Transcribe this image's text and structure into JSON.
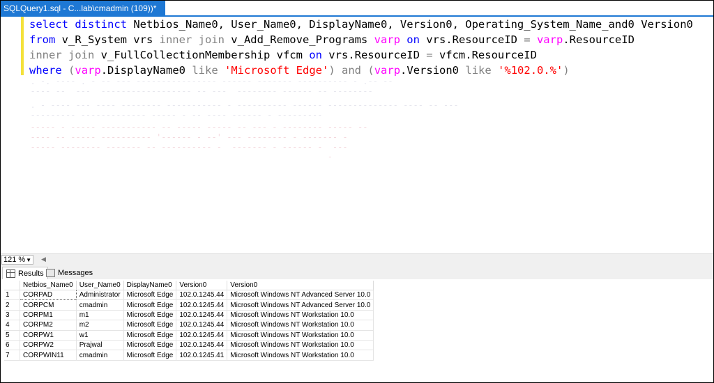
{
  "tab": {
    "title": "SQLQuery1.sql - C...lab\\cmadmin (109))*",
    "pin": "⊕",
    "close": "✕"
  },
  "editor": {
    "zoom": "121 %",
    "lines": [
      [
        [
          "kw",
          "select"
        ],
        [
          "t",
          " "
        ],
        [
          "kw",
          "distinct"
        ],
        [
          "t",
          " Netbios_Name0, User_Name0, DisplayName0, Version0, Operating_System_Name_and0 Version0"
        ]
      ],
      [
        [
          "kw",
          "from"
        ],
        [
          "t",
          " v_R_System vrs "
        ],
        [
          "op",
          "inner join"
        ],
        [
          "t",
          " v_Add_Remove_Programs "
        ],
        [
          "fn",
          "varp"
        ],
        [
          "t",
          " "
        ],
        [
          "kw",
          "on"
        ],
        [
          "t",
          " vrs.ResourceID "
        ],
        [
          "op",
          "="
        ],
        [
          "t",
          " "
        ],
        [
          "fn",
          "varp"
        ],
        [
          "t",
          ".ResourceID"
        ]
      ],
      [
        [
          "op",
          "inner join"
        ],
        [
          "t",
          " v_FullCollectionMembership vfcm "
        ],
        [
          "kw",
          "on"
        ],
        [
          "t",
          " vrs.ResourceID "
        ],
        [
          "op",
          "="
        ],
        [
          "t",
          " vfcm.ResourceID"
        ]
      ],
      [
        [
          "kw",
          "where"
        ],
        [
          "t",
          " "
        ],
        [
          "op",
          "("
        ],
        [
          "fn",
          "varp"
        ],
        [
          "t",
          ".DisplayName0 "
        ],
        [
          "op",
          "like"
        ],
        [
          "t",
          " "
        ],
        [
          "str",
          "'Microsoft Edge'"
        ],
        [
          "op",
          ")"
        ],
        [
          "t",
          " "
        ],
        [
          "op",
          "and"
        ],
        [
          "t",
          " "
        ],
        [
          "op",
          "("
        ],
        [
          "fn",
          "varp"
        ],
        [
          "t",
          ".Version0 "
        ],
        [
          "op",
          "like"
        ],
        [
          "t",
          " "
        ],
        [
          "str",
          "'%102.0.%'"
        ],
        [
          "op",
          ")"
        ]
      ]
    ]
  },
  "results_tabs": {
    "results": "Results",
    "messages": "Messages"
  },
  "results": {
    "columns": [
      "Netbios_Name0",
      "User_Name0",
      "DisplayName0",
      "Version0",
      "Version0"
    ],
    "rows": [
      [
        "1",
        "CORPAD",
        "Administrator",
        "Microsoft Edge",
        "102.0.1245.44",
        "Microsoft Windows NT Advanced Server 10.0"
      ],
      [
        "2",
        "CORPCM",
        "cmadmin",
        "Microsoft Edge",
        "102.0.1245.44",
        "Microsoft Windows NT Advanced Server 10.0"
      ],
      [
        "3",
        "CORPM1",
        "m1",
        "Microsoft Edge",
        "102.0.1245.44",
        "Microsoft Windows NT Workstation 10.0"
      ],
      [
        "4",
        "CORPM2",
        "m2",
        "Microsoft Edge",
        "102.0.1245.44",
        "Microsoft Windows NT Workstation 10.0"
      ],
      [
        "5",
        "CORPW1",
        "w1",
        "Microsoft Edge",
        "102.0.1245.44",
        "Microsoft Windows NT Workstation 10.0"
      ],
      [
        "6",
        "CORPW2",
        "Prajwal",
        "Microsoft Edge",
        "102.0.1245.44",
        "Microsoft Windows NT Workstation 10.0"
      ],
      [
        "7",
        "CORPWIN11",
        "cmadmin",
        "Microsoft Edge",
        "102.0.1245.41",
        "Microsoft Windows NT Workstation 10.0"
      ]
    ]
  },
  "colors": {
    "tab_accent": "#1e78d4",
    "keyword": "#0000ff",
    "operator": "#808080",
    "alias": "#ff00ff",
    "string": "#ff0000",
    "change_margin": "#f4e13a"
  },
  "icons": [
    "pin-icon",
    "close-icon",
    "results-grid-icon",
    "messages-icon",
    "scroll-left-icon",
    "dropdown-icon"
  ]
}
